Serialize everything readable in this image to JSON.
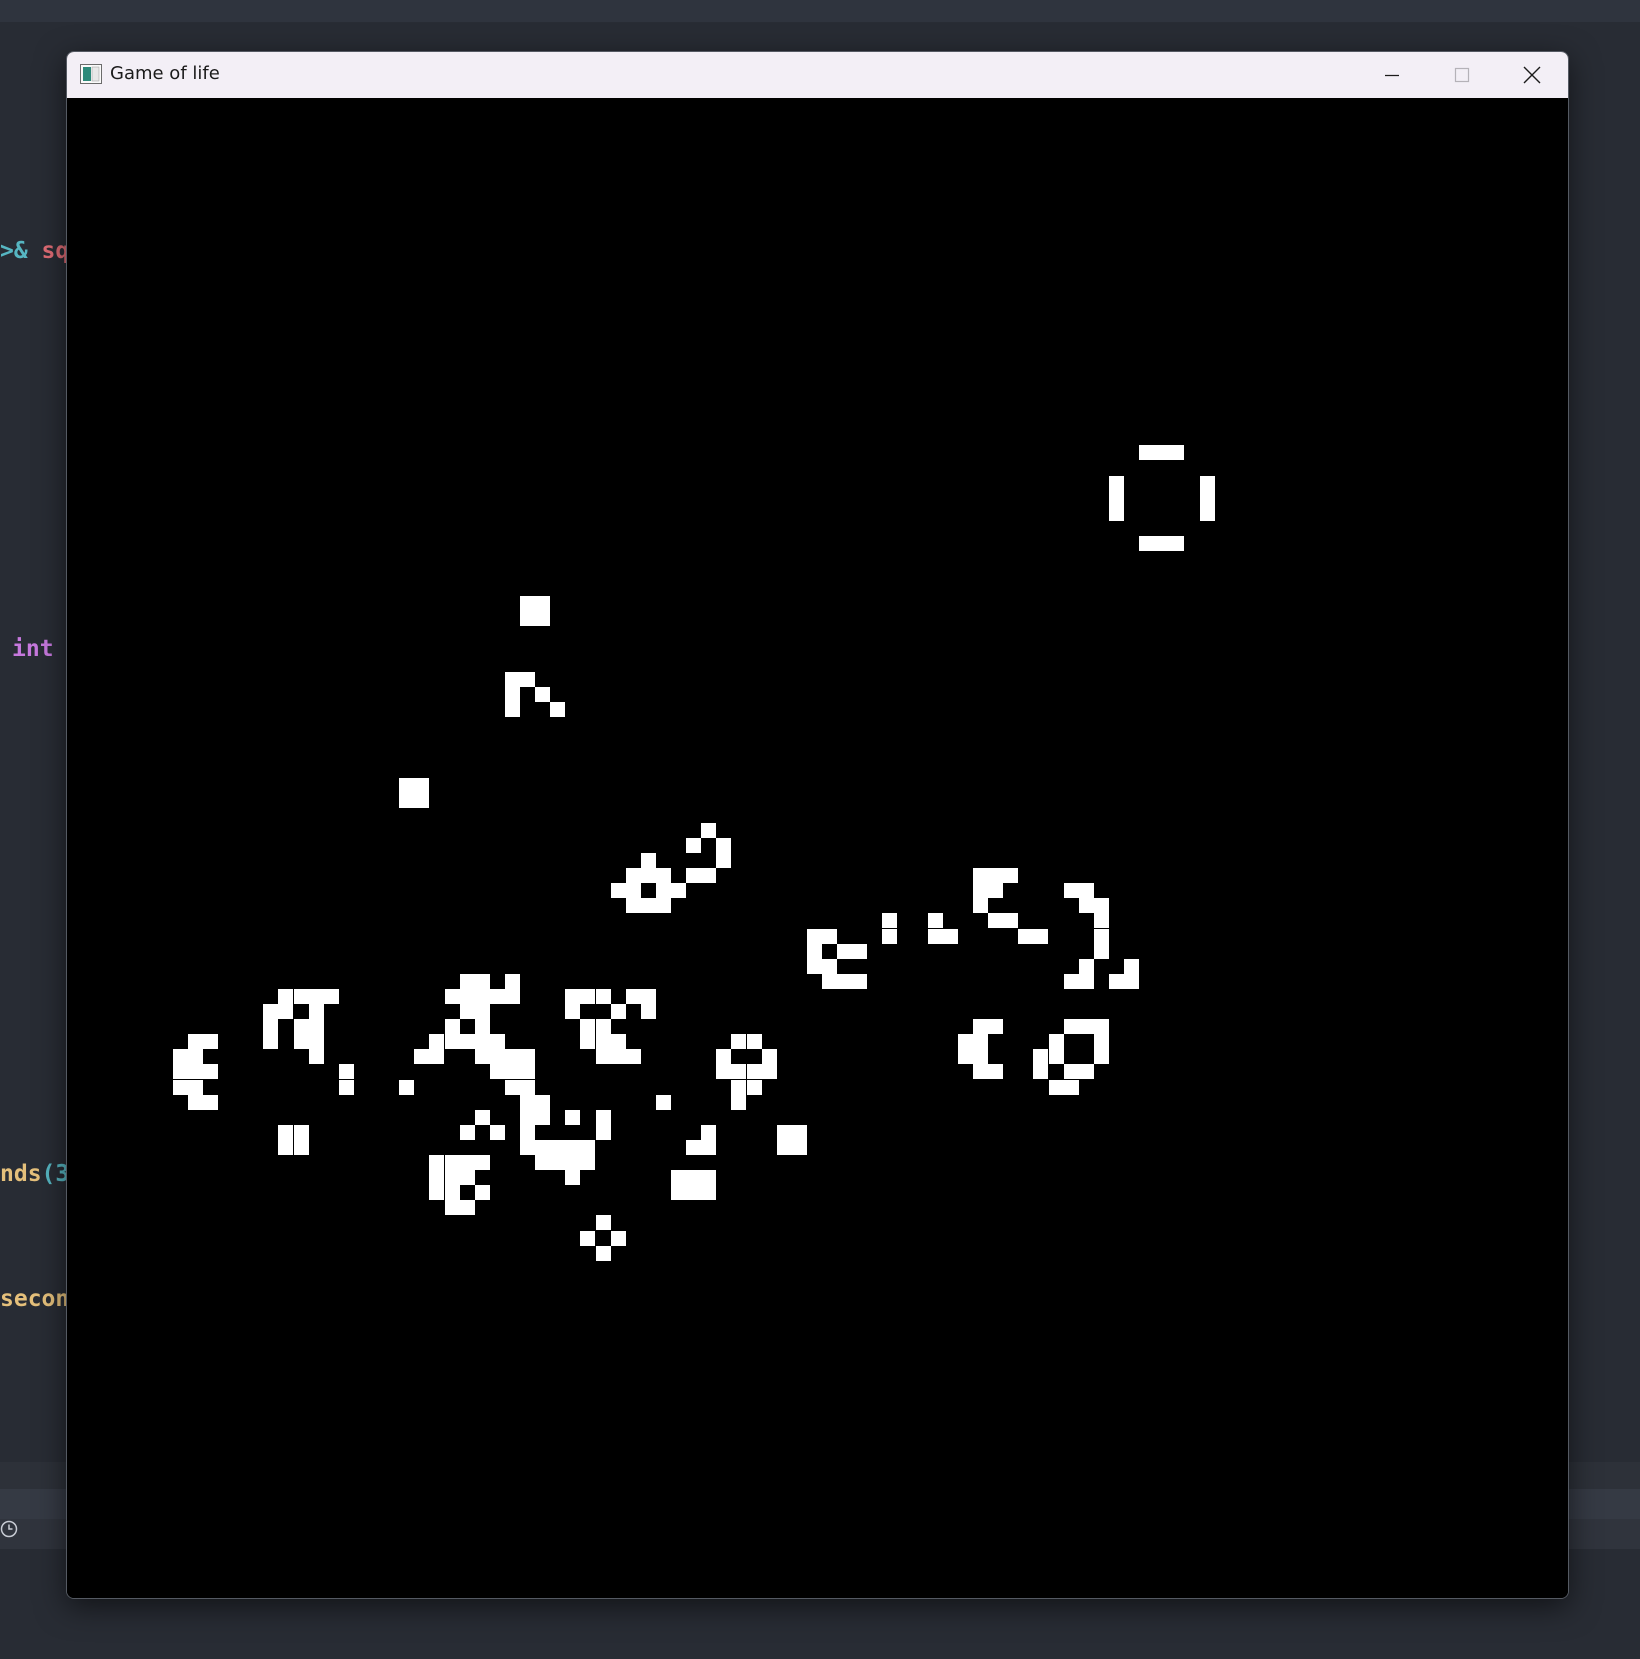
{
  "window": {
    "title": "Game of life",
    "icon": "app-window-icon",
    "controls": [
      "minimize-icon",
      "maximize-icon",
      "close-icon"
    ]
  },
  "background_editor": {
    "fragments": [
      {
        "parts": [
          {
            "text": ">& ",
            "color": "#56b6c2"
          },
          {
            "text": "sq",
            "color": "#e06c75"
          }
        ]
      },
      {
        "parts": [
          {
            "text": "int",
            "color": "#c678dd"
          }
        ]
      },
      {
        "parts": [
          {
            "text": "nds",
            "color": "#e5c07b"
          },
          {
            "text": "(3",
            "color": "#56b6c2"
          }
        ]
      },
      {
        "parts": [
          {
            "text": "secon",
            "color": "#e5c07b"
          }
        ]
      }
    ],
    "status_icon": "clock-icon"
  },
  "grid": {
    "cell_color": "#ffffff",
    "background_color": "#000000",
    "live_cells": [
      [
        71,
        23
      ],
      [
        72,
        23
      ],
      [
        73,
        23
      ],
      [
        69,
        25
      ],
      [
        75,
        25
      ],
      [
        69,
        26
      ],
      [
        75,
        26
      ],
      [
        69,
        27
      ],
      [
        75,
        27
      ],
      [
        71,
        29
      ],
      [
        72,
        29
      ],
      [
        73,
        29
      ],
      [
        30,
        33
      ],
      [
        31,
        33
      ],
      [
        30,
        34
      ],
      [
        31,
        34
      ],
      [
        29,
        38
      ],
      [
        30,
        38
      ],
      [
        29,
        39
      ],
      [
        31,
        39
      ],
      [
        29,
        40
      ],
      [
        32,
        40
      ],
      [
        22,
        45
      ],
      [
        23,
        45
      ],
      [
        22,
        46
      ],
      [
        23,
        46
      ],
      [
        42,
        48
      ],
      [
        41,
        49
      ],
      [
        43,
        49
      ],
      [
        38,
        50
      ],
      [
        43,
        50
      ],
      [
        37,
        51
      ],
      [
        38,
        51
      ],
      [
        39,
        51
      ],
      [
        41,
        51
      ],
      [
        42,
        51
      ],
      [
        36,
        52
      ],
      [
        37,
        52
      ],
      [
        39,
        52
      ],
      [
        40,
        52
      ],
      [
        37,
        53
      ],
      [
        38,
        53
      ],
      [
        39,
        53
      ],
      [
        60,
        51
      ],
      [
        61,
        51
      ],
      [
        62,
        51
      ],
      [
        66,
        52
      ],
      [
        60,
        52
      ],
      [
        61,
        52
      ],
      [
        66,
        52
      ],
      [
        67,
        52
      ],
      [
        60,
        53
      ],
      [
        67,
        53
      ],
      [
        68,
        53
      ],
      [
        68,
        54
      ],
      [
        61,
        54
      ],
      [
        62,
        54
      ],
      [
        68,
        55
      ],
      [
        63,
        55
      ],
      [
        64,
        55
      ],
      [
        68,
        56
      ],
      [
        54,
        54
      ],
      [
        57,
        54
      ],
      [
        54,
        55
      ],
      [
        57,
        55
      ],
      [
        58,
        55
      ],
      [
        49,
        55
      ],
      [
        50,
        55
      ],
      [
        49,
        56
      ],
      [
        51,
        56
      ],
      [
        50,
        57
      ],
      [
        52,
        56
      ],
      [
        50,
        58
      ],
      [
        51,
        58
      ],
      [
        52,
        58
      ],
      [
        49,
        57
      ],
      [
        66,
        58
      ],
      [
        67,
        58
      ],
      [
        69,
        58
      ],
      [
        70,
        58
      ],
      [
        67,
        57
      ],
      [
        70,
        57
      ],
      [
        14,
        59
      ],
      [
        15,
        59
      ],
      [
        16,
        59
      ],
      [
        17,
        59
      ],
      [
        25,
        59
      ],
      [
        26,
        59
      ],
      [
        27,
        59
      ],
      [
        28,
        59
      ],
      [
        26,
        58
      ],
      [
        27,
        58
      ],
      [
        27,
        60
      ],
      [
        26,
        60
      ],
      [
        29,
        58
      ],
      [
        29,
        59
      ],
      [
        33,
        59
      ],
      [
        34,
        59
      ],
      [
        35,
        59
      ],
      [
        37,
        59
      ],
      [
        38,
        59
      ],
      [
        36,
        60
      ],
      [
        33,
        60
      ],
      [
        38,
        60
      ],
      [
        13,
        60
      ],
      [
        14,
        60
      ],
      [
        16,
        60
      ],
      [
        13,
        61
      ],
      [
        15,
        61
      ],
      [
        16,
        61
      ],
      [
        13,
        62
      ],
      [
        15,
        62
      ],
      [
        16,
        62
      ],
      [
        16,
        63
      ],
      [
        25,
        61
      ],
      [
        27,
        61
      ],
      [
        24,
        62
      ],
      [
        25,
        62
      ],
      [
        26,
        62
      ],
      [
        27,
        62
      ],
      [
        28,
        62
      ],
      [
        23,
        63
      ],
      [
        24,
        63
      ],
      [
        27,
        63
      ],
      [
        28,
        63
      ],
      [
        29,
        63
      ],
      [
        30,
        63
      ],
      [
        34,
        61
      ],
      [
        35,
        61
      ],
      [
        34,
        62
      ],
      [
        35,
        62
      ],
      [
        36,
        62
      ],
      [
        35,
        63
      ],
      [
        36,
        63
      ],
      [
        37,
        63
      ],
      [
        60,
        61
      ],
      [
        61,
        61
      ],
      [
        59,
        62
      ],
      [
        60,
        62
      ],
      [
        59,
        63
      ],
      [
        60,
        63
      ],
      [
        60,
        64
      ],
      [
        61,
        64
      ],
      [
        66,
        61
      ],
      [
        67,
        61
      ],
      [
        68,
        61
      ],
      [
        65,
        62
      ],
      [
        68,
        62
      ],
      [
        64,
        63
      ],
      [
        65,
        63
      ],
      [
        68,
        63
      ],
      [
        64,
        64
      ],
      [
        66,
        64
      ],
      [
        67,
        64
      ],
      [
        65,
        65
      ],
      [
        66,
        65
      ],
      [
        8,
        62
      ],
      [
        9,
        62
      ],
      [
        7,
        63
      ],
      [
        8,
        63
      ],
      [
        7,
        64
      ],
      [
        8,
        64
      ],
      [
        9,
        64
      ],
      [
        7,
        65
      ],
      [
        8,
        65
      ],
      [
        8,
        66
      ],
      [
        9,
        66
      ],
      [
        44,
        62
      ],
      [
        45,
        62
      ],
      [
        43,
        63
      ],
      [
        46,
        63
      ],
      [
        43,
        64
      ],
      [
        44,
        64
      ],
      [
        45,
        64
      ],
      [
        46,
        64
      ],
      [
        44,
        65
      ],
      [
        45,
        65
      ],
      [
        44,
        66
      ],
      [
        28,
        64
      ],
      [
        29,
        64
      ],
      [
        30,
        64
      ],
      [
        29,
        65
      ],
      [
        30,
        65
      ],
      [
        30,
        66
      ],
      [
        31,
        66
      ],
      [
        30,
        67
      ],
      [
        31,
        67
      ],
      [
        18,
        64
      ],
      [
        18,
        65
      ],
      [
        22,
        65
      ],
      [
        39,
        66
      ],
      [
        30,
        68
      ],
      [
        35,
        68
      ],
      [
        31,
        69
      ],
      [
        32,
        69
      ],
      [
        33,
        69
      ],
      [
        34,
        69
      ],
      [
        27,
        67
      ],
      [
        26,
        68
      ],
      [
        28,
        68
      ],
      [
        30,
        69
      ],
      [
        14,
        68
      ],
      [
        15,
        68
      ],
      [
        14,
        69
      ],
      [
        15,
        69
      ],
      [
        42,
        68
      ],
      [
        41,
        69
      ],
      [
        42,
        69
      ],
      [
        47,
        68
      ],
      [
        48,
        68
      ],
      [
        47,
        69
      ],
      [
        48,
        69
      ],
      [
        33,
        67
      ],
      [
        35,
        67
      ],
      [
        24,
        70
      ],
      [
        25,
        70
      ],
      [
        26,
        70
      ],
      [
        24,
        71
      ],
      [
        25,
        71
      ],
      [
        26,
        71
      ],
      [
        27,
        70
      ],
      [
        24,
        72
      ],
      [
        25,
        72
      ],
      [
        27,
        72
      ],
      [
        25,
        73
      ],
      [
        26,
        73
      ],
      [
        40,
        71
      ],
      [
        41,
        71
      ],
      [
        42,
        71
      ],
      [
        40,
        72
      ],
      [
        41,
        72
      ],
      [
        42,
        72
      ],
      [
        35,
        74
      ],
      [
        34,
        75
      ],
      [
        36,
        75
      ],
      [
        35,
        76
      ],
      [
        33,
        70
      ],
      [
        34,
        70
      ],
      [
        32,
        70
      ],
      [
        31,
        70
      ],
      [
        33,
        71
      ]
    ]
  }
}
